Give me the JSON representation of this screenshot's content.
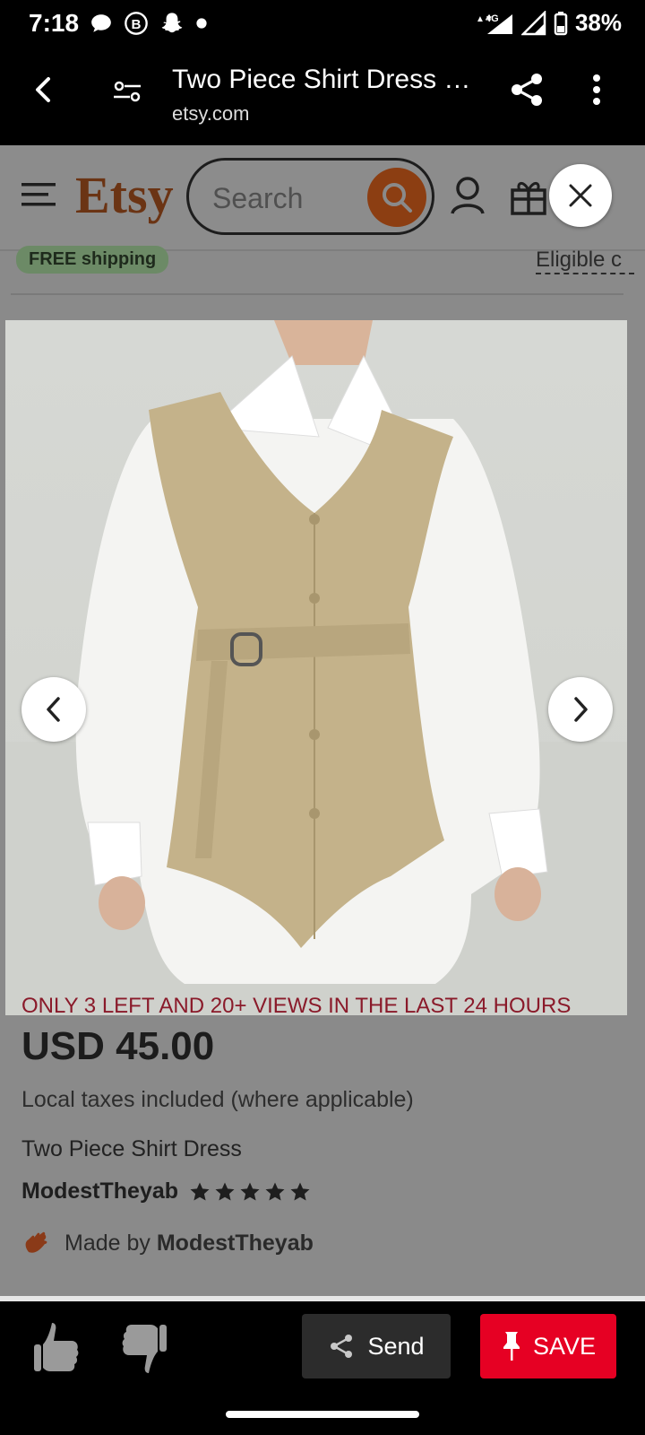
{
  "status": {
    "time": "7:18",
    "network": "4G",
    "battery": "38%"
  },
  "tab": {
    "title": "Two Piece Shirt Dress …",
    "url": "etsy.com"
  },
  "etsy": {
    "logo": "Etsy",
    "search_placeholder": "Search",
    "free_shipping": "FREE shipping",
    "eligible": "Eligible c"
  },
  "listing": {
    "scarcity": "ONLY 3 LEFT AND 20+ VIEWS IN THE LAST 24 HOURS",
    "price": "USD 45.00",
    "taxes": "Local taxes included (where applicable)",
    "title": "Two Piece Shirt Dress",
    "shop": "ModestTheyab",
    "rating_stars": 5,
    "made_by_prefix": "Made by",
    "made_by_shop": "ModestTheyab"
  },
  "actions": {
    "send": "Send",
    "save": "SAVE"
  },
  "colors": {
    "save": "#e60023",
    "etsy_orange": "#f1641e"
  }
}
